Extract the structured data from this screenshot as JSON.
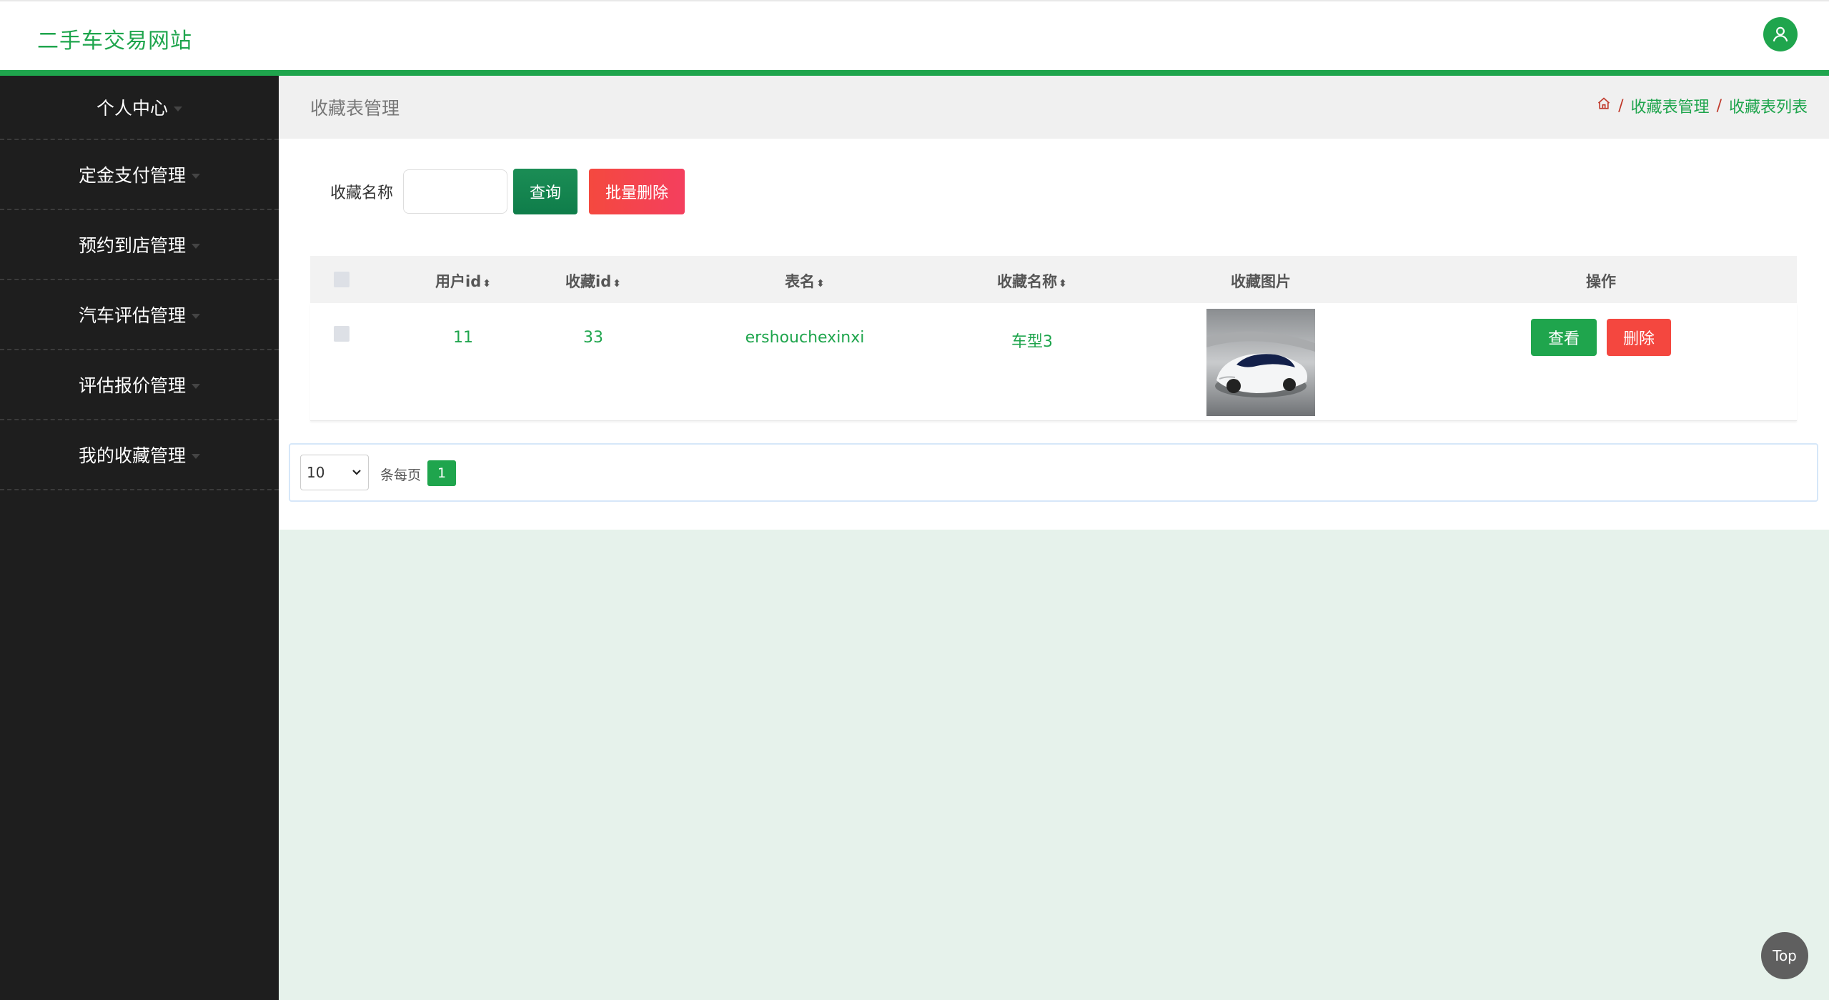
{
  "header": {
    "title": "二手车交易网站"
  },
  "sidebar": {
    "items": [
      {
        "label": "个人中心"
      },
      {
        "label": "定金支付管理"
      },
      {
        "label": "预约到店管理"
      },
      {
        "label": "汽车评估管理"
      },
      {
        "label": "评估报价管理"
      },
      {
        "label": "我的收藏管理"
      }
    ]
  },
  "page": {
    "title": "收藏表管理",
    "breadcrumb": [
      "收藏表管理",
      "收藏表列表"
    ],
    "separator": "/"
  },
  "search": {
    "label": "收藏名称",
    "query_label": "查询",
    "batch_delete_label": "批量删除"
  },
  "table": {
    "columns": [
      "用户id",
      "收藏id",
      "表名",
      "收藏名称",
      "收藏图片",
      "操作"
    ],
    "rows": [
      {
        "user_id": "11",
        "fav_id": "33",
        "table_name": "ershouchexinxi",
        "fav_name": "车型3",
        "view_label": "查看",
        "delete_label": "删除"
      }
    ]
  },
  "pagination": {
    "page_size": "10",
    "per_page_label": "条每页",
    "current_page": "1"
  },
  "back_to_top": "Top",
  "colors": {
    "accent": "#1fa54d",
    "danger": "#f4473f",
    "sidebar": "#1e1e1e"
  }
}
